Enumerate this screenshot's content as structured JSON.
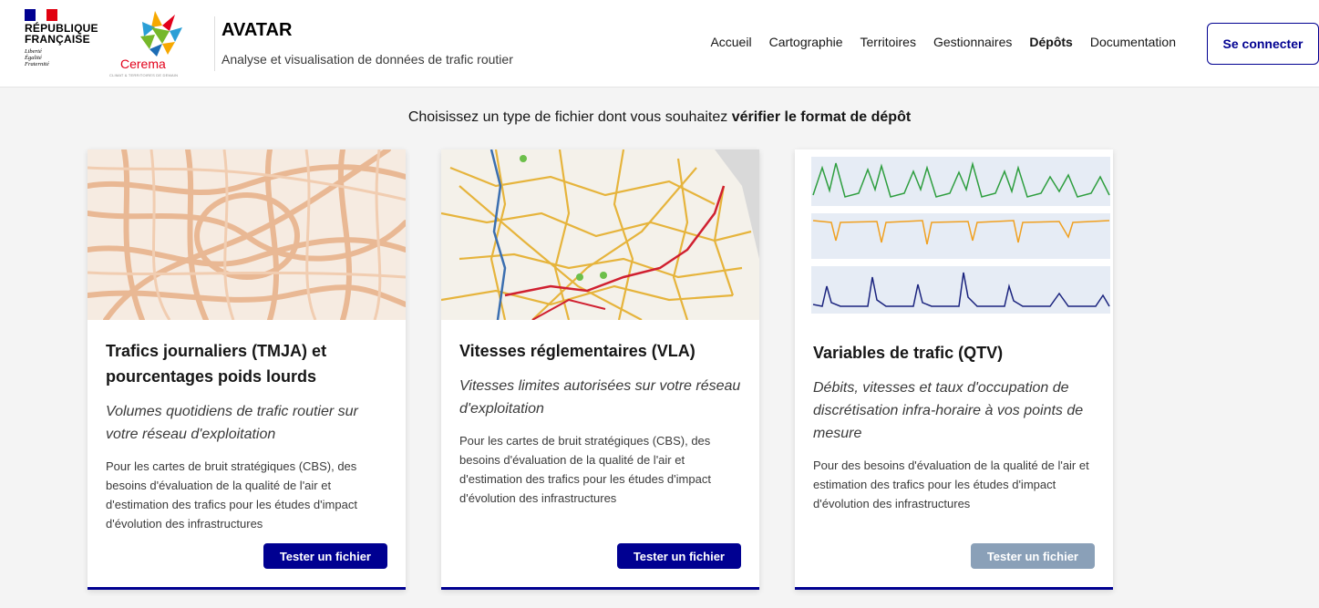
{
  "header": {
    "rf_line1": "RÉPUBLIQUE",
    "rf_line2": "FRANÇAISE",
    "motto": [
      "Liberté",
      "Égalité",
      "Fraternité"
    ],
    "partner_name": "Cerema",
    "partner_tagline": "CLIMAT & TERRITOIRES DE DEMAIN",
    "app_title": "AVATAR",
    "app_subtitle": "Analyse et visualisation de données de trafic routier",
    "nav": [
      {
        "label": "Accueil"
      },
      {
        "label": "Cartographie"
      },
      {
        "label": "Territoires"
      },
      {
        "label": "Gestionnaires"
      },
      {
        "label": "Dépôts"
      },
      {
        "label": "Documentation"
      }
    ],
    "active_nav": "Dépôts",
    "login_label": "Se connecter"
  },
  "intro": {
    "text": "Choisissez un type de fichier dont vous souhaitez ",
    "bold": "vérifier le format de dépôt"
  },
  "cards": [
    {
      "title": "Trafics journaliers (TMJA) et pourcentages poids lourds",
      "subtitle": "Volumes quotidiens de trafic routier sur votre réseau d'exploitation",
      "description": "Pour les cartes de bruit stratégiques (CBS), des besoins d'évaluation de la qualité de l'air et d'estimation des trafics pour les études d'impact d'évolution des infrastructures",
      "button": "Tester un fichier",
      "button_enabled": true
    },
    {
      "title": "Vitesses réglementaires (VLA)",
      "subtitle": "Vitesses limites autorisées sur votre réseau d'exploitation",
      "description": "Pour les cartes de bruit stratégiques (CBS), des besoins d'évaluation de la qualité de l'air et d'estimation des trafics pour les études d'impact d'évolution des infrastructures",
      "button": "Tester un fichier",
      "button_enabled": true
    },
    {
      "title": "Variables de trafic (QTV)",
      "subtitle": "Débits, vitesses et taux d'occupation de discrétisation infra-horaire à vos points de mesure",
      "description": "Pour des besoins d'évaluation de la qualité de l'air et estimation des trafics pour les études d'impact d'évolution des infrastructures",
      "button": "Tester un fichier",
      "button_enabled": false
    }
  ],
  "colors": {
    "primary": "#000091",
    "disabled": "#8aa0b8",
    "flag_blue": "#000091",
    "flag_red": "#e1000f",
    "cerema_red": "#e2001a"
  }
}
